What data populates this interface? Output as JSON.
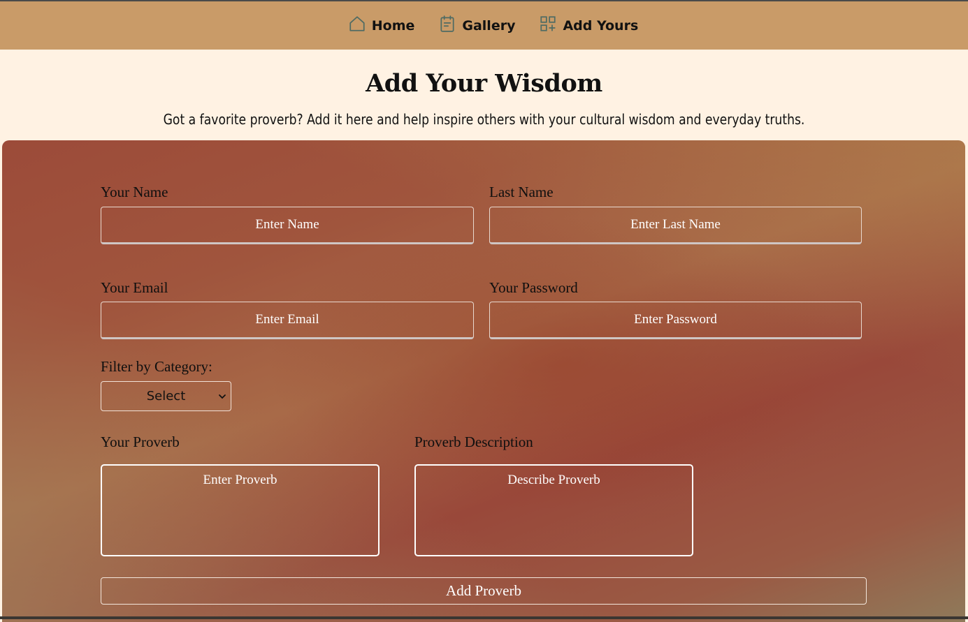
{
  "nav": {
    "items": [
      {
        "label": "Home",
        "icon": "home-icon"
      },
      {
        "label": "Gallery",
        "icon": "calendar-icon"
      },
      {
        "label": "Add Yours",
        "icon": "grid-plus-icon"
      }
    ],
    "icon_color": "#4f6b63"
  },
  "hero": {
    "title": "Add Your Wisdom",
    "subtitle": "Got a favorite proverb? Add it here and help inspire others with your cultural wisdom and everyday truths."
  },
  "form": {
    "first_name": {
      "label": "Your Name",
      "placeholder": "Enter Name"
    },
    "last_name": {
      "label": "Last Name",
      "placeholder": "Enter Last Name"
    },
    "email": {
      "label": "Your Email",
      "placeholder": "Enter Email"
    },
    "password": {
      "label": "Your Password",
      "placeholder": "Enter Password"
    },
    "category": {
      "label": "Filter by Category:",
      "selected": "Select"
    },
    "proverb": {
      "label": "Your Proverb",
      "placeholder": "Enter Proverb"
    },
    "description": {
      "label": "Proverb Description",
      "placeholder": "Describe Proverb"
    },
    "submit_label": "Add Proverb"
  },
  "colors": {
    "navbar": "#c99b68",
    "page_background": "#fff2e3",
    "panel_primary": "#9c4b39"
  }
}
